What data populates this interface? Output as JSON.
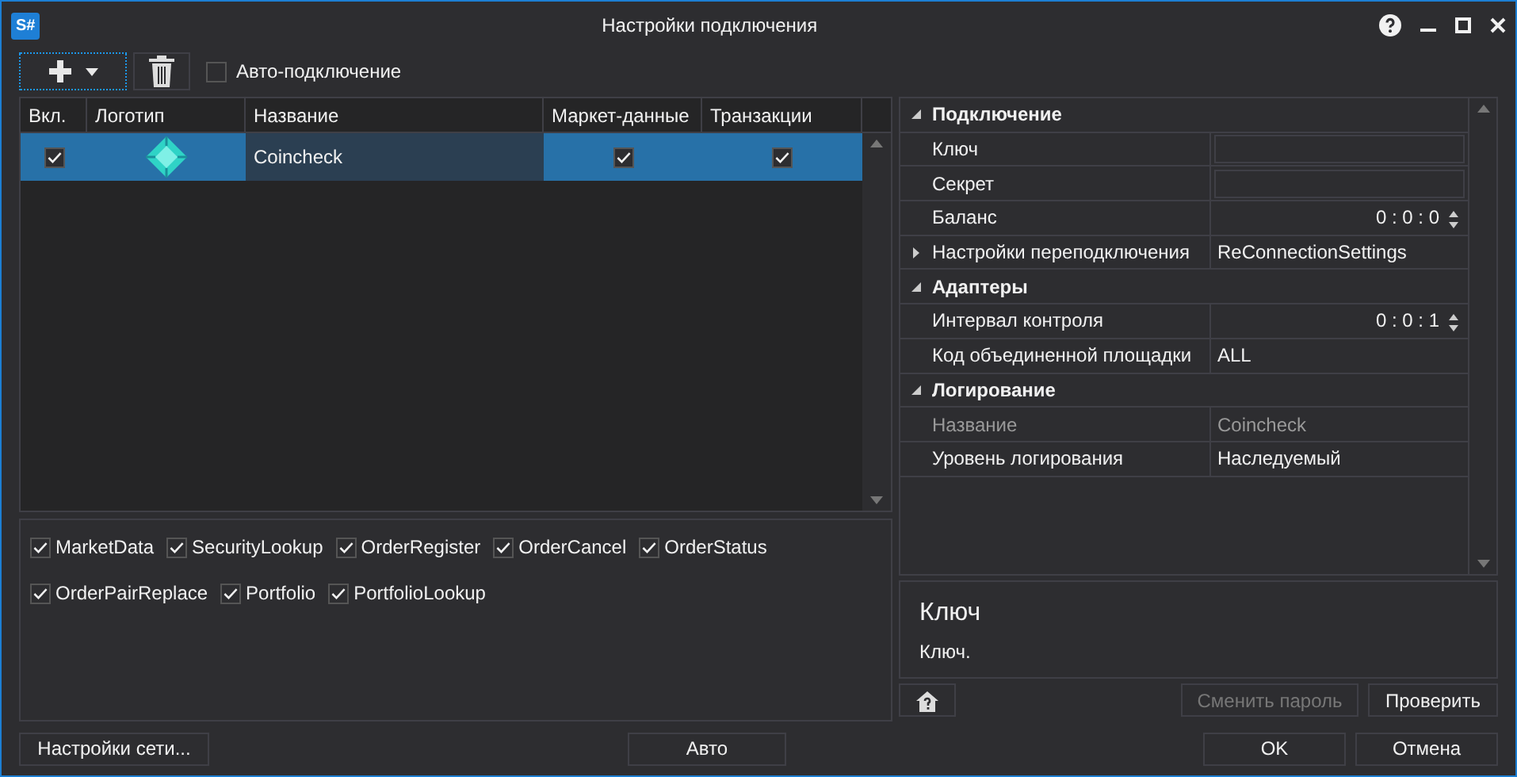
{
  "window": {
    "title": "Настройки подключения",
    "icon_text": "S#"
  },
  "toolbar": {
    "auto_connect": {
      "label": "Авто-подключение",
      "checked": false
    }
  },
  "connections": {
    "columns": [
      "Вкл.",
      "Логотип",
      "Название",
      "Маркет-данные",
      "Транзакции"
    ],
    "rows": [
      {
        "enabled": true,
        "name": "Coincheck",
        "market_data": true,
        "transactions": true,
        "selected": true
      }
    ]
  },
  "capabilities": [
    {
      "label": "MarketData",
      "checked": true
    },
    {
      "label": "SecurityLookup",
      "checked": true
    },
    {
      "label": "OrderRegister",
      "checked": true
    },
    {
      "label": "OrderCancel",
      "checked": true
    },
    {
      "label": "OrderStatus",
      "checked": true
    },
    {
      "label": "OrderPairReplace",
      "checked": true
    },
    {
      "label": "Portfolio",
      "checked": true
    },
    {
      "label": "PortfolioLookup",
      "checked": true
    }
  ],
  "properties": [
    {
      "kind": "category",
      "label": "Подключение",
      "expanded": true,
      "disabled": false
    },
    {
      "kind": "field",
      "label": "Ключ",
      "disabled": false
    },
    {
      "kind": "field",
      "label": "Секрет",
      "disabled": false
    },
    {
      "kind": "spin",
      "label": "Баланс",
      "value": "0 : 0 : 0",
      "disabled": false
    },
    {
      "kind": "expandable",
      "label": "Настройки переподключения",
      "value": "ReConnectionSettings",
      "expanded": false,
      "disabled": false
    },
    {
      "kind": "category",
      "label": "Адаптеры",
      "expanded": true,
      "disabled": false
    },
    {
      "kind": "spin",
      "label": "Интервал контроля",
      "value": "0 : 0 : 1",
      "disabled": false
    },
    {
      "kind": "text",
      "label": "Код объединенной площадки",
      "value": "ALL",
      "disabled": false
    },
    {
      "kind": "category",
      "label": "Логирование",
      "expanded": true,
      "disabled": false
    },
    {
      "kind": "text",
      "label": "Название",
      "value": "Coincheck",
      "disabled": true
    },
    {
      "kind": "text",
      "label": "Уровень логирования",
      "value": "Наследуемый",
      "disabled": false
    }
  ],
  "description": {
    "title": "Ключ",
    "text": "Ключ."
  },
  "buttons": {
    "change_password": {
      "label": "Сменить пароль",
      "disabled": true
    },
    "verify": {
      "label": "Проверить",
      "disabled": false
    },
    "network_settings": {
      "label": "Настройки сети..."
    },
    "auto": {
      "label": "Авто"
    },
    "ok": {
      "label": "OK"
    },
    "cancel": {
      "label": "Отмена"
    }
  }
}
